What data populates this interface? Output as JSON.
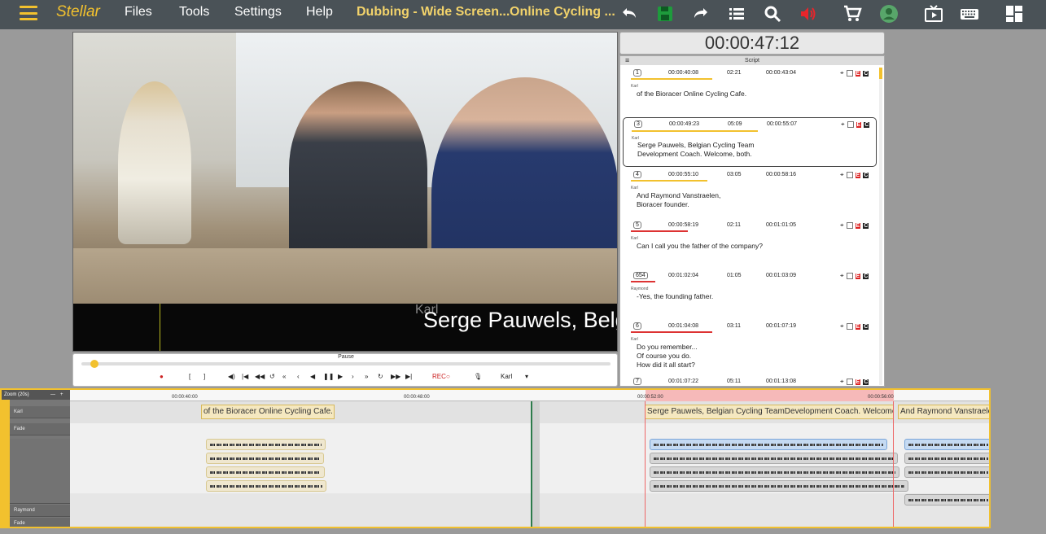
{
  "topbar": {
    "logo": "Stellar",
    "menu": [
      "Files",
      "Tools",
      "Settings",
      "Help"
    ],
    "project_name": "Dubbing - Wide Screen...",
    "video_name": "Online Cycling ..."
  },
  "player": {
    "subtitle": "Serge Pauwels, Belgian C",
    "speaker_overlay": "Karl",
    "timecode": "00:00:47:12",
    "pause_label": "Pause",
    "rec_label": "REC",
    "speaker_select": "Karl"
  },
  "script": {
    "title": "Script",
    "cues": [
      {
        "num": "1",
        "in": "00:00:40:08",
        "dur": "02:21",
        "out": "00:00:43:04",
        "speaker": "Karl",
        "text": "of the Bioracer Online Cycling Cafe."
      },
      {
        "num": "3",
        "in": "00:00:49:23",
        "dur": "05:09",
        "out": "00:00:55:07",
        "speaker": "Karl",
        "text": "Serge Pauwels, Belgian Cycling Team\nDevelopment Coach. Welcome, both."
      },
      {
        "num": "4",
        "in": "00:00:55:10",
        "dur": "03:05",
        "out": "00:00:58:16",
        "speaker": "Karl",
        "text": "And Raymond Vanstraelen,\nBioracer founder."
      },
      {
        "num": "5",
        "in": "00:00:58:19",
        "dur": "02:11",
        "out": "00:01:01:05",
        "speaker": "Karl",
        "text": "Can I call you the father of the company?"
      },
      {
        "num": "654",
        "in": "00:01:02:04",
        "dur": "01:05",
        "out": "00:01:03:09",
        "speaker": "Raymond",
        "text": "-Yes, the founding father."
      },
      {
        "num": "6",
        "in": "00:01:04:08",
        "dur": "03:11",
        "out": "00:01:07:19",
        "speaker": "Karl",
        "text": "Do you remember...\nOf course you do.\nHow did it all start?"
      },
      {
        "num": "7",
        "in": "00:01:07:22",
        "dur": "05:11",
        "out": "00:01:13:08",
        "speaker": "",
        "text": ""
      }
    ]
  },
  "timeline": {
    "zoom": "Zoom (20s)",
    "ruler": [
      "00:00:40:00",
      "00:00:48:00",
      "00:00:52:00",
      "00:00:56:00"
    ],
    "tracks": [
      "Karl",
      "Fade",
      "Raymond",
      "Fade"
    ],
    "clips": [
      "of the Bioracer Online Cycling Cafe.",
      "Serge Pauwels, Belgian Cycling TeamDevelopment Coach. Welcome, both.",
      "And Raymond Vanstraelen"
    ]
  }
}
